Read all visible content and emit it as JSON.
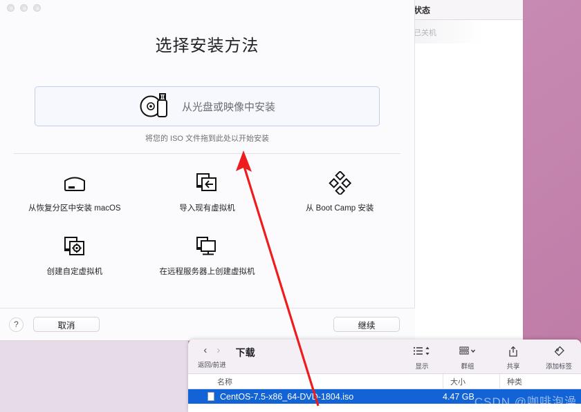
{
  "assistant": {
    "title": "选择安装方法",
    "dropzone": {
      "label": "从光盘或映像中安装",
      "icon": "disc-usb-icon",
      "hint": "将您的 ISO 文件拖到此处以开始安装"
    },
    "methods": [
      {
        "label": "从恢复分区中安装 macOS",
        "icon": "hard-drive-icon"
      },
      {
        "label": "导入现有虚拟机",
        "icon": "import-vm-icon"
      },
      {
        "label": "从 Boot Camp 安装",
        "icon": "boot-camp-icon"
      },
      {
        "label": "创建自定虚拟机",
        "icon": "custom-vm-gear-icon"
      },
      {
        "label": "在远程服务器上创建虚拟机",
        "icon": "remote-server-display-icon"
      }
    ],
    "footer": {
      "help": "?",
      "cancel": "取消",
      "continue": "继续"
    }
  },
  "background_window": {
    "header": "状态",
    "status": "已关机"
  },
  "finder": {
    "nav_label": "返回/前进",
    "back_icon": "chevron-left-icon",
    "forward_icon": "chevron-right-icon",
    "title": "下载",
    "toolbar": [
      {
        "label": "显示",
        "icon": "list-view-icon"
      },
      {
        "label": "群组",
        "icon": "group-grid-icon"
      },
      {
        "label": "共享",
        "icon": "share-icon"
      },
      {
        "label": "添加标签",
        "icon": "tag-icon"
      }
    ],
    "columns": {
      "name": "名称",
      "size": "大小",
      "kind": "种类"
    },
    "rows": [
      {
        "name": "CentOS-7.5-x86_64-DVD-1804.iso",
        "size": "4.47 GB",
        "icon": "document-icon",
        "selected": true
      }
    ],
    "watermark": "CSDN @咖啡泡澡"
  },
  "colors": {
    "accent_selection": "#1263d6",
    "annotation": "#ee1c1c",
    "desktop": "#c78ab2"
  }
}
